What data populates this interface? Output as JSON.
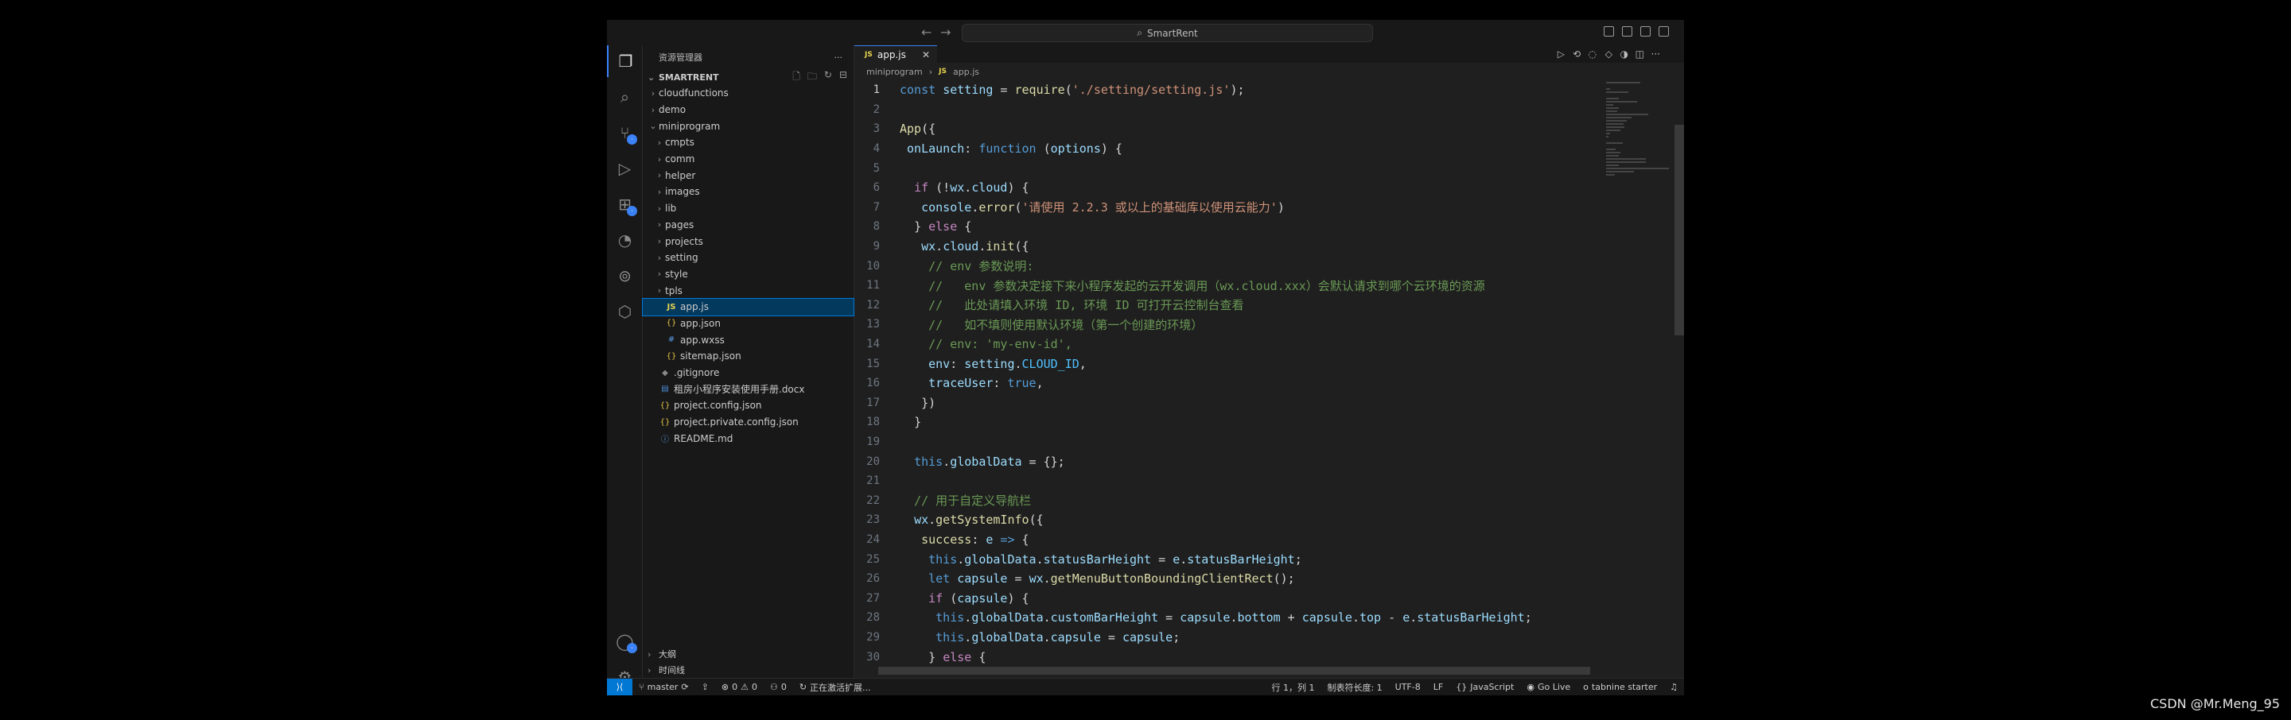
{
  "titlebar": {
    "search_label": "SmartRent"
  },
  "sidebar": {
    "header": "资源管理器",
    "root": "SMARTRENT",
    "tree": [
      {
        "label": "cloudfunctions",
        "type": "folder",
        "depth": 0
      },
      {
        "label": "demo",
        "type": "folder",
        "depth": 0
      },
      {
        "label": "miniprogram",
        "type": "folder-open",
        "depth": 0
      },
      {
        "label": "cmpts",
        "type": "folder",
        "depth": 1
      },
      {
        "label": "comm",
        "type": "folder",
        "depth": 1
      },
      {
        "label": "helper",
        "type": "folder",
        "depth": 1
      },
      {
        "label": "images",
        "type": "folder",
        "depth": 1
      },
      {
        "label": "lib",
        "type": "folder",
        "depth": 1
      },
      {
        "label": "pages",
        "type": "folder",
        "depth": 1
      },
      {
        "label": "projects",
        "type": "folder",
        "depth": 1
      },
      {
        "label": "setting",
        "type": "folder",
        "depth": 1
      },
      {
        "label": "style",
        "type": "folder",
        "depth": 1
      },
      {
        "label": "tpls",
        "type": "folder",
        "depth": 1
      },
      {
        "label": "app.js",
        "type": "js",
        "depth": 1,
        "selected": true
      },
      {
        "label": "app.json",
        "type": "json",
        "depth": 1
      },
      {
        "label": "app.wxss",
        "type": "css",
        "depth": 1
      },
      {
        "label": "sitemap.json",
        "type": "json",
        "depth": 1
      },
      {
        "label": ".gitignore",
        "type": "git",
        "depth": 0
      },
      {
        "label": "租房小程序安装使用手册.docx",
        "type": "doc",
        "depth": 0
      },
      {
        "label": "project.config.json",
        "type": "json",
        "depth": 0
      },
      {
        "label": "project.private.config.json",
        "type": "json",
        "depth": 0
      },
      {
        "label": "README.md",
        "type": "info",
        "depth": 0
      }
    ],
    "outline": "大纲",
    "timeline": "时间线"
  },
  "editor": {
    "tab": "app.js",
    "breadcrumb": [
      "miniprogram",
      "app.js"
    ],
    "current_line": 1,
    "lines": [
      [
        [
          "kw",
          "const"
        ],
        [
          "ct",
          " "
        ],
        [
          "var",
          "setting"
        ],
        [
          "pu",
          " = "
        ],
        [
          "fn",
          "require"
        ],
        [
          "pu",
          "("
        ],
        [
          "str",
          "'./setting/setting.js'"
        ],
        [
          "pu",
          ");"
        ]
      ],
      [],
      [
        [
          "fn",
          "App"
        ],
        [
          "pu",
          "({"
        ]
      ],
      [
        [
          "ct",
          " "
        ],
        [
          "var",
          "onLaunch"
        ],
        [
          "pu",
          ": "
        ],
        [
          "kw",
          "function"
        ],
        [
          "pu",
          " ("
        ],
        [
          "var",
          "options"
        ],
        [
          "pu",
          ") {"
        ]
      ],
      [],
      [
        [
          "ct",
          "  "
        ],
        [
          "ctrl",
          "if"
        ],
        [
          "pu",
          " (!"
        ],
        [
          "var",
          "wx"
        ],
        [
          "pu",
          "."
        ],
        [
          "var",
          "cloud"
        ],
        [
          "pu",
          ") {"
        ]
      ],
      [
        [
          "ct",
          "   "
        ],
        [
          "var",
          "console"
        ],
        [
          "pu",
          "."
        ],
        [
          "fn",
          "error"
        ],
        [
          "pu",
          "("
        ],
        [
          "str",
          "'请使用 2.2.3 或以上的基础库以使用云能力'"
        ],
        [
          "pu",
          ")"
        ]
      ],
      [
        [
          "ct",
          "  "
        ],
        [
          "pu",
          "} "
        ],
        [
          "ctrl",
          "else"
        ],
        [
          "pu",
          " {"
        ]
      ],
      [
        [
          "ct",
          "   "
        ],
        [
          "var",
          "wx"
        ],
        [
          "pu",
          "."
        ],
        [
          "var",
          "cloud"
        ],
        [
          "pu",
          "."
        ],
        [
          "fn",
          "init"
        ],
        [
          "pu",
          "({"
        ]
      ],
      [
        [
          "ct",
          "    "
        ],
        [
          "com",
          "// env 参数说明:"
        ]
      ],
      [
        [
          "ct",
          "    "
        ],
        [
          "com",
          "//   env 参数决定接下来小程序发起的云开发调用（wx.cloud.xxx）会默认请求到哪个云环境的资源"
        ]
      ],
      [
        [
          "ct",
          "    "
        ],
        [
          "com",
          "//   此处请填入环境 ID, 环境 ID 可打开云控制台查看"
        ]
      ],
      [
        [
          "ct",
          "    "
        ],
        [
          "com",
          "//   如不填则使用默认环境（第一个创建的环境）"
        ]
      ],
      [
        [
          "ct",
          "    "
        ],
        [
          "com",
          "// env: 'my-env-id',"
        ]
      ],
      [
        [
          "ct",
          "    "
        ],
        [
          "var",
          "env"
        ],
        [
          "pu",
          ": "
        ],
        [
          "var",
          "setting"
        ],
        [
          "pu",
          "."
        ],
        [
          "const",
          "CLOUD_ID"
        ],
        [
          "pu",
          ","
        ]
      ],
      [
        [
          "ct",
          "    "
        ],
        [
          "var",
          "traceUser"
        ],
        [
          "pu",
          ": "
        ],
        [
          "kw",
          "true"
        ],
        [
          "pu",
          ","
        ]
      ],
      [
        [
          "ct",
          "   "
        ],
        [
          "pu",
          "})"
        ]
      ],
      [
        [
          "ct",
          "  "
        ],
        [
          "pu",
          "}"
        ]
      ],
      [],
      [
        [
          "ct",
          "  "
        ],
        [
          "kw",
          "this"
        ],
        [
          "pu",
          "."
        ],
        [
          "var",
          "globalData"
        ],
        [
          "pu",
          " = {};"
        ]
      ],
      [],
      [
        [
          "ct",
          "  "
        ],
        [
          "com",
          "// 用于自定义导航栏"
        ]
      ],
      [
        [
          "ct",
          "  "
        ],
        [
          "var",
          "wx"
        ],
        [
          "pu",
          "."
        ],
        [
          "fn",
          "getSystemInfo"
        ],
        [
          "pu",
          "({"
        ]
      ],
      [
        [
          "ct",
          "   "
        ],
        [
          "fn",
          "success"
        ],
        [
          "pu",
          ": "
        ],
        [
          "var",
          "e"
        ],
        [
          "kw",
          " =>"
        ],
        [
          "pu",
          " {"
        ]
      ],
      [
        [
          "ct",
          "    "
        ],
        [
          "kw",
          "this"
        ],
        [
          "pu",
          "."
        ],
        [
          "var",
          "globalData"
        ],
        [
          "pu",
          "."
        ],
        [
          "var",
          "statusBarHeight"
        ],
        [
          "pu",
          " = "
        ],
        [
          "var",
          "e"
        ],
        [
          "pu",
          "."
        ],
        [
          "var",
          "statusBarHeight"
        ],
        [
          "pu",
          ";"
        ]
      ],
      [
        [
          "ct",
          "    "
        ],
        [
          "kw",
          "let"
        ],
        [
          "ct",
          " "
        ],
        [
          "var",
          "capsule"
        ],
        [
          "pu",
          " = "
        ],
        [
          "var",
          "wx"
        ],
        [
          "pu",
          "."
        ],
        [
          "fn",
          "getMenuButtonBoundingClientRect"
        ],
        [
          "pu",
          "();"
        ]
      ],
      [
        [
          "ct",
          "    "
        ],
        [
          "ctrl",
          "if"
        ],
        [
          "pu",
          " ("
        ],
        [
          "var",
          "capsule"
        ],
        [
          "pu",
          ") {"
        ]
      ],
      [
        [
          "ct",
          "     "
        ],
        [
          "kw",
          "this"
        ],
        [
          "pu",
          "."
        ],
        [
          "var",
          "globalData"
        ],
        [
          "pu",
          "."
        ],
        [
          "var",
          "customBarHeight"
        ],
        [
          "pu",
          " = "
        ],
        [
          "var",
          "capsule"
        ],
        [
          "pu",
          "."
        ],
        [
          "var",
          "bottom"
        ],
        [
          "pu",
          " + "
        ],
        [
          "var",
          "capsule"
        ],
        [
          "pu",
          "."
        ],
        [
          "var",
          "top"
        ],
        [
          "pu",
          " - "
        ],
        [
          "var",
          "e"
        ],
        [
          "pu",
          "."
        ],
        [
          "var",
          "statusBarHeight"
        ],
        [
          "pu",
          ";"
        ]
      ],
      [
        [
          "ct",
          "     "
        ],
        [
          "kw",
          "this"
        ],
        [
          "pu",
          "."
        ],
        [
          "var",
          "globalData"
        ],
        [
          "pu",
          "."
        ],
        [
          "var",
          "capsule"
        ],
        [
          "pu",
          " = "
        ],
        [
          "var",
          "capsule"
        ],
        [
          "pu",
          ";"
        ]
      ],
      [
        [
          "ct",
          "    "
        ],
        [
          "pu",
          "} "
        ],
        [
          "ctrl",
          "else"
        ],
        [
          "pu",
          " {"
        ]
      ]
    ]
  },
  "statusbar": {
    "branch": "master",
    "errors": "0",
    "warnings": "0",
    "ports": "0",
    "activating": "正在激活扩展...",
    "position": "行 1，列 1",
    "tab_size": "制表符长度: 1",
    "encoding": "UTF-8",
    "eol": "LF",
    "language": "JavaScript",
    "go_live": "Go Live",
    "tabnine": "tabnine starter"
  },
  "watermark": "CSDN @Mr.Meng_95",
  "colors": {
    "accent": "#0078d4",
    "selection": "#04395e",
    "background": "#181818",
    "editor_bg": "#1f1f1f"
  }
}
